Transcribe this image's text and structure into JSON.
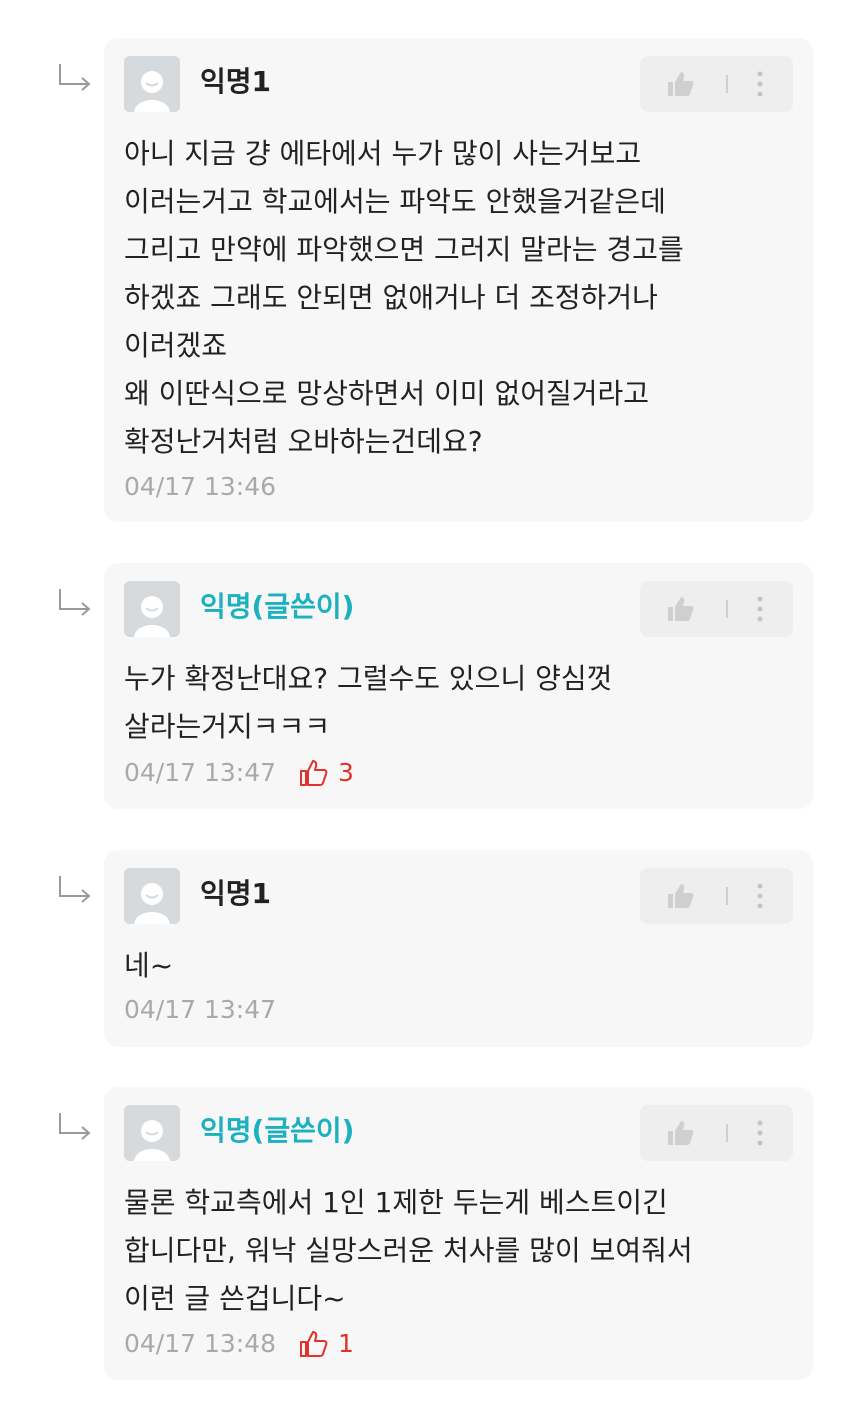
{
  "comments": [
    {
      "author": "익명1",
      "is_author_op": false,
      "text": "아니 지금 걍 에타에서 누가 많이 사는거보고\n이러는거고 학교에서는 파악도 안했을거같은데\n그리고 만약에 파악했으면  그러지 말라는 경고를\n하겠죠 그래도 안되면 없애거나 더 조정하거나\n이러겠죠\n왜 이딴식으로 망상하면서 이미 없어질거라고\n확정난거처럼 오바하는건데요?",
      "timestamp": "04/17 13:46",
      "votes": ""
    },
    {
      "author": "익명(글쓴이)",
      "is_author_op": true,
      "text": "누가 확정난대요? 그럴수도 있으니 양심껏\n살라는거지ㅋㅋㅋ",
      "timestamp": "04/17 13:47",
      "votes": "3"
    },
    {
      "author": "익명1",
      "is_author_op": false,
      "text": "네~",
      "timestamp": "04/17 13:47",
      "votes": ""
    },
    {
      "author": "익명(글쓴이)",
      "is_author_op": true,
      "text": "물론 학교측에서 1인 1제한 두는게 베스트이긴\n합니다만, 워낙 실망스러운 처사를 많이 보여줘서\n이런 글 쓴겁니다~",
      "timestamp": "04/17 13:48",
      "votes": "1"
    }
  ],
  "colors": {
    "op_name": "#1bb1bf",
    "vote": "#e0322c",
    "card_bg": "#f7f7f7"
  },
  "icons": {
    "reply": "reply-arrow-icon",
    "like": "thumbs-up-icon",
    "more": "more-vertical-icon",
    "avatar": "default-avatar-icon",
    "vote": "vote-thumbs-up-icon"
  }
}
